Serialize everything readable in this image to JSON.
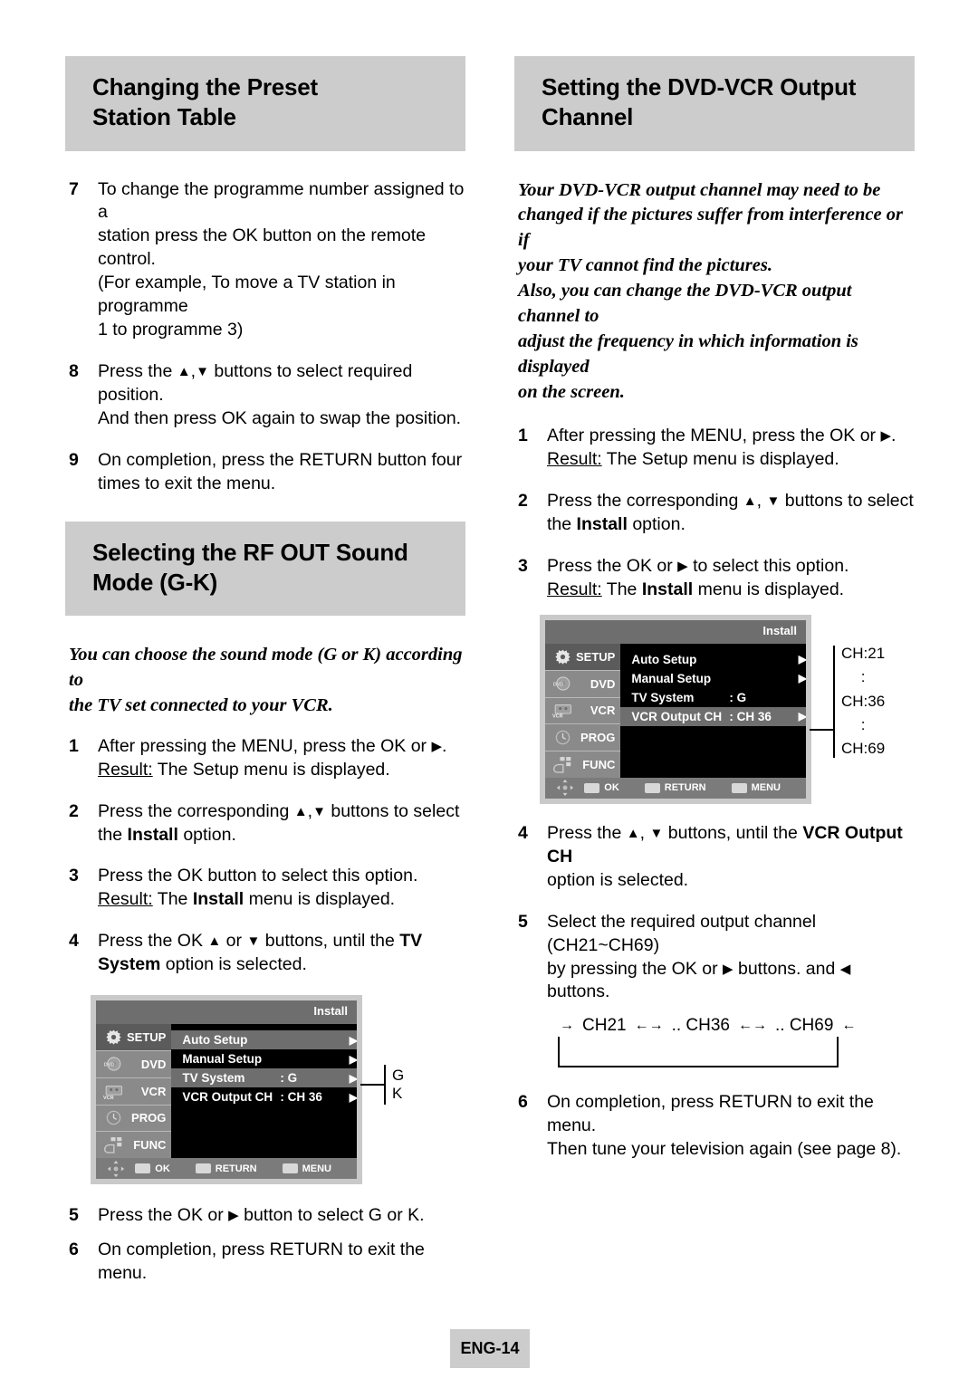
{
  "left_column": {
    "section1": {
      "heading_line1": "Changing the Preset",
      "heading_line2": "Station Table",
      "steps": [
        {
          "num": "7",
          "lines": [
            "To change the programme number assigned to a",
            "station press the OK button on the remote control.",
            "(For example, To move a TV station in programme",
            "1 to programme 3)"
          ]
        },
        {
          "num": "8",
          "line1_a": "Press the",
          "line1_b": "buttons to select required position.",
          "line2": "And then press OK again to swap the position."
        },
        {
          "num": "9",
          "lines": [
            "On completion, press the RETURN button four",
            "times to exit the menu."
          ]
        }
      ]
    },
    "section2": {
      "heading_line1": "Selecting the RF OUT Sound",
      "heading_line2": "Mode (G-K)",
      "intro_line1": "You can choose the sound mode (G or K) according to",
      "intro_line2": "the TV set connected to your VCR.",
      "step1": {
        "num": "1",
        "line1_a": "After pressing the MENU, press the OK or",
        "line1_b": ".",
        "result_label": "Result:",
        "result_text": "The Setup menu is displayed."
      },
      "step2": {
        "num": "2",
        "line1_a": "Press the corresponding",
        "line1_b": "buttons to select",
        "line2_a": "the",
        "line2_bold": "Install",
        "line2_b": "option."
      },
      "step3": {
        "num": "3",
        "line1": "Press the OK button to select this option.",
        "result_label": "Result:",
        "result_a": "The",
        "result_bold": "Install",
        "result_b": "menu is displayed."
      },
      "step4": {
        "num": "4",
        "line1_a": "Press the OK",
        "line1_b": "or",
        "line1_c": "buttons, until the",
        "line1_bold": "TV",
        "line2_bold": "System",
        "line2_b": "option is selected."
      },
      "step5": {
        "num": "5",
        "line1_a": "Press the OK or",
        "line1_b": "button to select G or K."
      },
      "step6": {
        "num": "6",
        "line1": "On completion, press RETURN to exit the menu."
      },
      "osd": {
        "title": "Install",
        "sidebar": [
          {
            "label": "SETUP",
            "icon": "gear-icon",
            "active": true
          },
          {
            "label": "DVD",
            "icon": "dvd-disc-icon",
            "active": false
          },
          {
            "label": "VCR",
            "icon": "vcr-tape-icon",
            "active": false
          },
          {
            "label": "PROG",
            "icon": "clock-icon",
            "active": false
          },
          {
            "label": "FUNC",
            "icon": "function-grid-icon",
            "active": false
          }
        ],
        "rows": [
          {
            "label": "Auto Setup",
            "value": "",
            "arrow": "▶",
            "selected": false
          },
          {
            "label": "Manual Setup",
            "value": "",
            "arrow": "▶",
            "selected": false
          },
          {
            "label": "TV System",
            "value": ": G",
            "arrow": "▶",
            "selected": true
          },
          {
            "label": "VCR Output CH",
            "value": ": CH 36",
            "arrow": "▶",
            "selected": false
          }
        ],
        "footer": [
          {
            "label": "OK",
            "icon": "ok-button-icon"
          },
          {
            "label": "RETURN",
            "icon": "return-button-icon"
          },
          {
            "label": "MENU",
            "icon": "menu-button-icon"
          }
        ],
        "callout_labels": [
          "G",
          "K"
        ]
      }
    }
  },
  "right_column": {
    "section": {
      "heading_line1": "Setting the DVD-VCR Output",
      "heading_line2": "Channel",
      "intro_lines": [
        "Your DVD-VCR output channel may need to be",
        "changed if the pictures suffer from interference or if",
        "your TV cannot find the pictures.",
        "Also, you can change the DVD-VCR output channel to",
        "adjust the frequency in which information is displayed",
        "on the screen."
      ],
      "step1": {
        "num": "1",
        "line1_a": "After pressing the MENU, press the OK or",
        "line1_b": ".",
        "result_label": "Result:",
        "result_text": "The Setup menu is displayed."
      },
      "step2": {
        "num": "2",
        "line1_a": "Press the corresponding",
        "line1_b": "buttons to select",
        "line2_a": "the",
        "line2_bold": "Install",
        "line2_b": "option."
      },
      "step3": {
        "num": "3",
        "line1_a": "Press the OK or",
        "line1_b": "to select this option.",
        "result_label": "Result:",
        "result_a": "The",
        "result_bold": "Install",
        "result_b": "menu is displayed."
      },
      "step4": {
        "num": "4",
        "line1_a": "Press the",
        "line1_b": "buttons, until the",
        "line1_bold": "VCR Output CH",
        "line2": "option is selected."
      },
      "step5": {
        "num": "5",
        "line1": "Select the required output channel (CH21~CH69)",
        "line2_a": "by pressing the  OK or",
        "line2_b": "buttons. and",
        "line2_c": "buttons."
      },
      "step6": {
        "num": "6",
        "line1": "On completion, press RETURN to exit the menu.",
        "line2": "Then tune your television again (see page 8)."
      },
      "cycle": {
        "start_arrow": "→",
        "ch1": "CH21",
        "sep1": "←→",
        "dots1": ".. CH36",
        "sep2": "←→",
        "dots2": ".. CH69",
        "end_arrow": "←"
      },
      "osd": {
        "title": "Install",
        "sidebar": [
          {
            "label": "SETUP",
            "icon": "gear-icon",
            "active": true
          },
          {
            "label": "DVD",
            "icon": "dvd-disc-icon",
            "active": false
          },
          {
            "label": "VCR",
            "icon": "vcr-tape-icon",
            "active": false
          },
          {
            "label": "PROG",
            "icon": "clock-icon",
            "active": false
          },
          {
            "label": "FUNC",
            "icon": "function-grid-icon",
            "active": false
          }
        ],
        "rows": [
          {
            "label": "Auto Setup",
            "value": "",
            "arrow": "▶",
            "selected": false
          },
          {
            "label": "Manual Setup",
            "value": "",
            "arrow": "▶",
            "selected": false
          },
          {
            "label": "TV System",
            "value": ": G",
            "arrow": "",
            "selected": false
          },
          {
            "label": "VCR Output CH",
            "value": ": CH 36",
            "arrow": "▶",
            "selected": true
          }
        ],
        "footer": [
          {
            "label": "OK",
            "icon": "ok-button-icon"
          },
          {
            "label": "RETURN",
            "icon": "return-button-icon"
          },
          {
            "label": "MENU",
            "icon": "menu-button-icon"
          }
        ],
        "callout_labels": [
          "CH:21",
          ":",
          "CH:36",
          ":",
          "CH:69"
        ]
      }
    }
  },
  "footer": {
    "page_label": "ENG-14"
  },
  "glyphs": {
    "triangle_right": "▶",
    "triangle_left": "◀",
    "triangle_up": "▲",
    "triangle_down": "▼",
    "comma": ","
  },
  "colors": {
    "heading_bar": "#cccccc",
    "osd_sidebar": "#8a8a8a",
    "osd_highlight": "#6e6e6e",
    "osd_background": "#000000"
  }
}
